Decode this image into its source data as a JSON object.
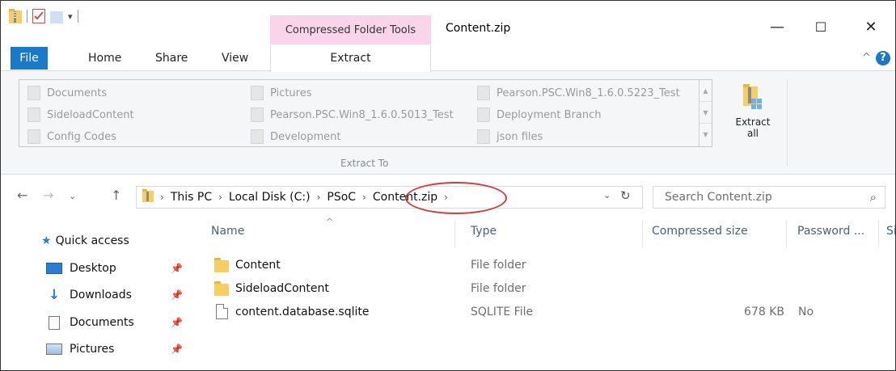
{
  "window": {
    "title": "Content.zip",
    "context_tab": "Compressed Folder Tools",
    "minimize_glyph": "—",
    "maximize_glyph": "☐",
    "close_glyph": "✕"
  },
  "ribbon_tabs": {
    "file": "File",
    "home": "Home",
    "share": "Share",
    "view": "View",
    "extract": "Extract",
    "collapse_glyph": "^",
    "help_glyph": "?"
  },
  "extract_to": {
    "group_label": "Extract To",
    "col1": [
      "Documents",
      "SideloadContent",
      "Config Codes"
    ],
    "col2": [
      "Pictures",
      "Pearson.PSC.Win8_1.6.0.5013_Test",
      "Development"
    ],
    "col3": [
      "Pearson.PSC.Win8_1.6.0.5223_Test",
      "Deployment Branch",
      "json files"
    ],
    "extract_all_line1": "Extract",
    "extract_all_line2": "all"
  },
  "address": {
    "crumbs": [
      "This PC",
      "Local Disk (C:)",
      "PSoC",
      "Content.zip"
    ],
    "search_placeholder": "Search Content.zip"
  },
  "nav": {
    "items": [
      {
        "label": "Quick access",
        "icon": "star-icon"
      },
      {
        "label": "Desktop",
        "icon": "desktop-icon"
      },
      {
        "label": "Downloads",
        "icon": "download-icon"
      },
      {
        "label": "Documents",
        "icon": "documents-icon"
      },
      {
        "label": "Pictures",
        "icon": "pictures-icon"
      }
    ]
  },
  "columns": {
    "name": "Name",
    "type": "Type",
    "compressed_size": "Compressed size",
    "password": "Password ...",
    "size_trunc": "Si"
  },
  "files": [
    {
      "name": "Content",
      "type": "File folder",
      "compressed_size": "",
      "password": "",
      "icon": "folder-icon"
    },
    {
      "name": "SideloadContent",
      "type": "File folder",
      "compressed_size": "",
      "password": "",
      "icon": "folder-icon"
    },
    {
      "name": "content.database.sqlite",
      "type": "SQLITE File",
      "compressed_size": "678 KB",
      "password": "No",
      "icon": "file-icon"
    }
  ],
  "colors": {
    "file_tab": "#1979ca",
    "context_tab": "#f9d4ea",
    "highlight_oval": "#d33b3b",
    "folder": "#f6cf62"
  }
}
